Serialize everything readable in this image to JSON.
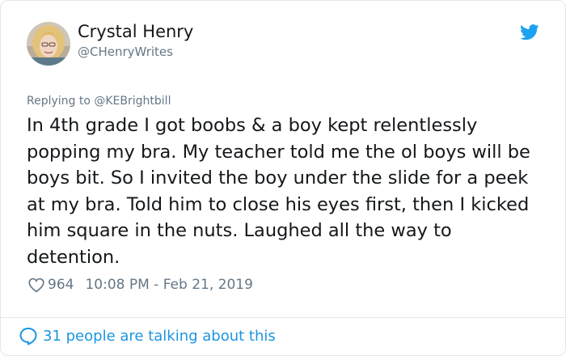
{
  "author": {
    "display_name": "Crystal Henry",
    "handle": "@CHenryWrites"
  },
  "reply_to": "Replying to @KEBrightbill",
  "tweet": {
    "text": "In 4th grade I got boobs & a boy kept relentlessly popping my bra. My teacher told me the ol boys will be boys bit. So I invited the boy under the slide for a peek at my bra. Told him to close his eyes first, then I kicked him square in the nuts. Laughed all the way to detention."
  },
  "meta": {
    "likes": "964",
    "timestamp": "10:08 PM - Feb 21, 2019"
  },
  "footer": {
    "conversation_label": "31 people are talking about this"
  },
  "icons": {
    "brand": "twitter-bird-icon",
    "like": "heart-icon",
    "reply": "speech-bubble-icon"
  },
  "colors": {
    "twitter_blue": "#1da1f2",
    "link_blue": "#1b95e0",
    "secondary_text": "#657786",
    "primary_text": "#14171a",
    "border": "#e1e8ed"
  }
}
